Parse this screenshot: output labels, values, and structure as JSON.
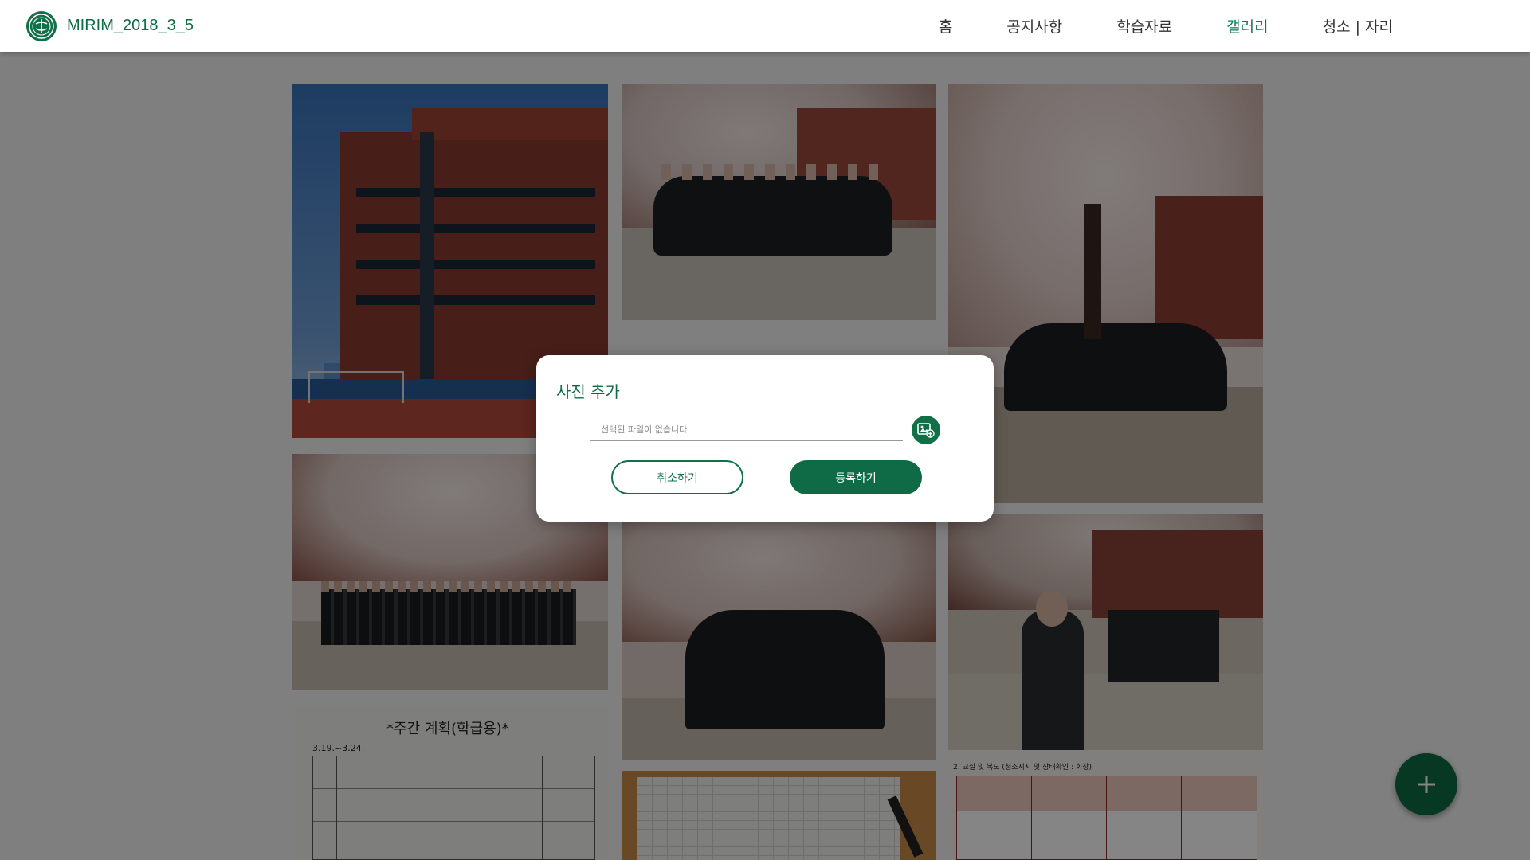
{
  "header": {
    "brand": "MIRIM_2018_3_5",
    "logo_icon": "school-emblem-icon",
    "nav": [
      {
        "label": "홈",
        "active": false
      },
      {
        "label": "공지사항",
        "active": false
      },
      {
        "label": "학습자료",
        "active": false
      },
      {
        "label": "갤러리",
        "active": true
      },
      {
        "label": "청소 | 자리",
        "active": false
      }
    ]
  },
  "gallery": {
    "photos": [
      {
        "subject": "school building"
      },
      {
        "subject": "class group under cherry blossoms"
      },
      {
        "subject": "class group under cherry blossom tree"
      },
      {
        "subject": "students in a row under cherry blossoms"
      },
      {
        "subject": "students posing under cherry blossoms"
      },
      {
        "subject": "student in front of group"
      },
      {
        "subject": "weekly plan sheet"
      },
      {
        "subject": "paper on desk"
      },
      {
        "subject": "cleaning duty table"
      }
    ],
    "weekly_plan_title": "*주간 계획(학급용)*",
    "weekly_plan_date": "3.19.~3.24.",
    "duty_title": "2. 교실 및 복도 (청소지시 및 상태확인 : 회장)"
  },
  "modal": {
    "title": "사진 추가",
    "file_placeholder": "선택된 파일이 없습니다",
    "file_icon": "add-image-icon",
    "cancel_label": "취소하기",
    "submit_label": "등록하기"
  },
  "fab": {
    "icon": "plus-icon"
  },
  "colors": {
    "brand_green": "#0f6b45",
    "active_nav": "#0f7a55"
  }
}
